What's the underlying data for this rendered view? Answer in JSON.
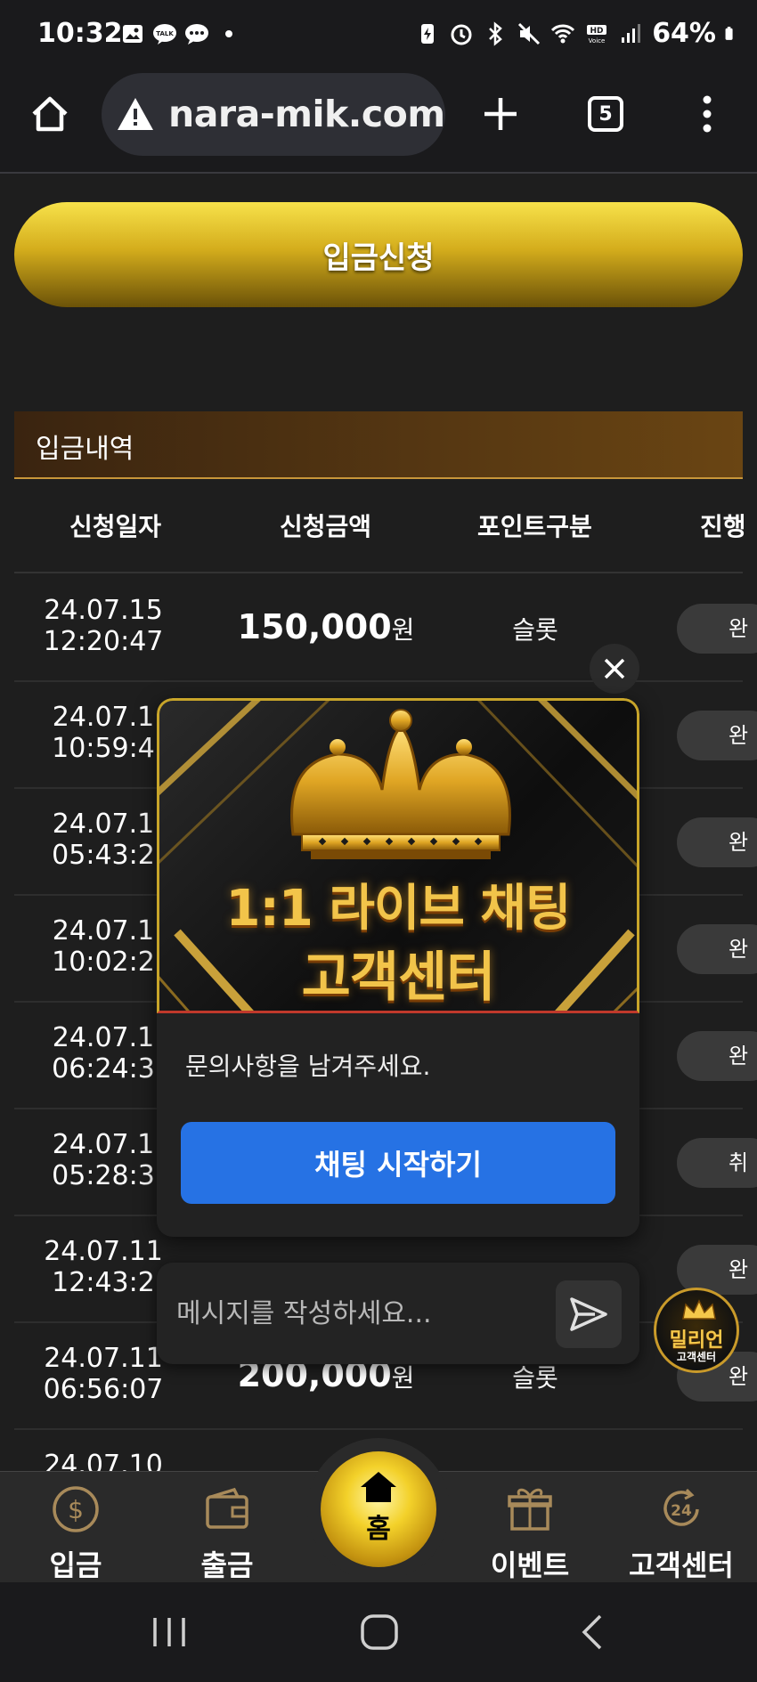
{
  "status_bar": {
    "time": "10:32",
    "battery": "64%"
  },
  "browser": {
    "url": "nara-mik.com",
    "tab_count": "5"
  },
  "deposit": {
    "request_button": "입금신청",
    "history_title": "입금내역",
    "columns": [
      "신청일자",
      "신청금액",
      "포인트구분",
      "진행"
    ],
    "rows": [
      {
        "date": "24.07.15",
        "time": "12:20:47",
        "amount": "150,000",
        "unit": "원",
        "point": "슬롯",
        "status": "완"
      },
      {
        "date": "24.07.1",
        "time": "10:59:4",
        "amount": "",
        "unit": "",
        "point": "",
        "status": "완"
      },
      {
        "date": "24.07.1",
        "time": "05:43:2",
        "amount": "",
        "unit": "",
        "point": "",
        "status": "완"
      },
      {
        "date": "24.07.1",
        "time": "10:02:2",
        "amount": "",
        "unit": "",
        "point": "",
        "status": "완"
      },
      {
        "date": "24.07.1",
        "time": "06:24:3",
        "amount": "",
        "unit": "",
        "point": "",
        "status": "완"
      },
      {
        "date": "24.07.1",
        "time": "05:28:3",
        "amount": "",
        "unit": "",
        "point": "",
        "status": "취"
      },
      {
        "date": "24.07.11",
        "time": "12:43:2",
        "amount": "",
        "unit": "",
        "point": "",
        "status": "완"
      },
      {
        "date": "24.07.11",
        "time": "06:56:07",
        "amount": "200,000",
        "unit": "원",
        "point": "슬롯",
        "status": "완"
      },
      {
        "date": "24.07.10",
        "time": "",
        "amount": "",
        "unit": "",
        "point": "",
        "status": ""
      }
    ]
  },
  "chat": {
    "banner_line1": "1:1 라이브 채팅",
    "banner_line2": "고객센터",
    "prompt": "문의사항을 남겨주세요.",
    "start_button": "채팅 시작하기",
    "input_placeholder": "메시지를 작성하세요...",
    "badge_title": "밀리언",
    "badge_subtitle": "고객센터"
  },
  "bottom_nav": {
    "deposit": "입금",
    "withdraw": "출금",
    "home": "홈",
    "event": "이벤트",
    "support": "고객센터"
  },
  "colors": {
    "gold": "#d4ad1c",
    "chat_button": "#2672e4",
    "background": "#1e1e1e"
  }
}
